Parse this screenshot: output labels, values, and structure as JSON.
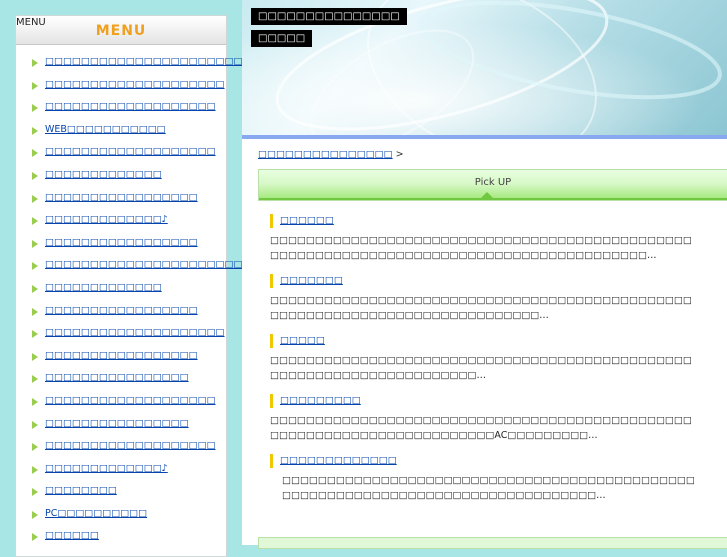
{
  "sidebar": {
    "menu_alt": "MENU",
    "menu_title": "MENU",
    "items": [
      {
        "label": "□□□□□□□□□□□□□□□□□□□□□□□"
      },
      {
        "label": "□□□□□□□□□□□□□□□□□□□□"
      },
      {
        "label": "□□□□□□□□□□□□□□□□□□□"
      },
      {
        "label": "WEB□□□□□□□□□□□"
      },
      {
        "label": "□□□□□□□□□□□□□□□□□□□"
      },
      {
        "label": "□□□□□□□□□□□□□"
      },
      {
        "label": "□□□□□□□□□□□□□□□□□"
      },
      {
        "label": "□□□□□□□□□□□□□♪"
      },
      {
        "label": "□□□□□□□□□□□□□□□□□"
      },
      {
        "label": "□□□□□□□□□□□□□□□□□□□□□□□□□"
      },
      {
        "label": "□□□□□□□□□□□□□"
      },
      {
        "label": "□□□□□□□□□□□□□□□□□"
      },
      {
        "label": "□□□□□□□□□□□□□□□□□□□□"
      },
      {
        "label": "□□□□□□□□□□□□□□□□□"
      },
      {
        "label": "□□□□□□□□□□□□□□□□"
      },
      {
        "label": "□□□□□□□□□□□□□□□□□□□"
      },
      {
        "label": "□□□□□□□□□□□□□□□□"
      },
      {
        "label": "□□□□□□□□□□□□□□□□□□□"
      },
      {
        "label": "□□□□□□□□□□□□□♪"
      },
      {
        "label": "□□□□□□□□"
      },
      {
        "label": "PC□□□□□□□□□□"
      },
      {
        "label": "□□□□□□"
      }
    ]
  },
  "header": {
    "site_title": "□□□□□□□□□□□□□□□",
    "site_sub": "□□□□□"
  },
  "main": {
    "breadcrumb_link": "□□□□□□□□□□□□□□□",
    "breadcrumb_sep": " >",
    "pickup_label": "Pick UP",
    "articles": [
      {
        "title": "□□□□□□",
        "body": "□□□□□□□□□□□□□□□□□□□□□□□□□□□□□□□□□□□□□□□□□□□□□□□□□□□□□□□□□□□□□□□□□□□□□□□□□□□□□□□□□□□□□□□□□…"
      },
      {
        "title": "□□□□□□□",
        "body": "□□□□□□□□□□□□□□□□□□□□□□□□□□□□□□□□□□□□□□□□□□□□□□□□□□□□□□□□□□□□□□□□□□□□□□□□□□□□□…"
      },
      {
        "title": "□□□□□",
        "body": "□□□□□□□□□□□□□□□□□□□□□□□□□□□□□□□□□□□□□□□□□□□□□□□□□□□□□□□□□□□□□□□□□□□□□□…"
      },
      {
        "title": "□□□□□□□□□",
        "body": "□□□□□□□□□□□□□□□□□□□□□□□□□□□□□□□□□□□□□□□□□□□□□□□□□□□□□□□□□□□□□□□□□□□□□□□□AC□□□□□□□□□…"
      },
      {
        "title": "□□□□□□□□□□□□□",
        "body": "□□□□□□□□□□□□□□□□□□□□□□□□□□□□□□□□□□□□□□□□□□□□□□□□□□□□□□□□□□□□□□□□□□□□□□□□□□□□□□□□□…"
      }
    ]
  }
}
